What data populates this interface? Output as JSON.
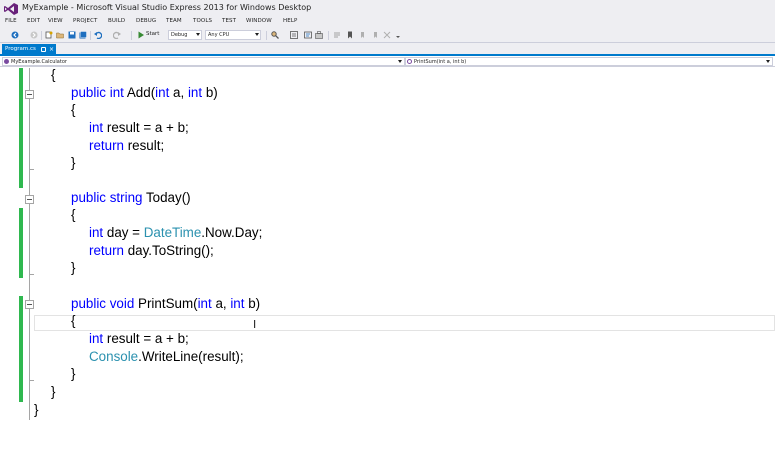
{
  "window": {
    "title": "MyExample - Microsoft Visual Studio Express 2013 for Windows Desktop"
  },
  "menu": [
    "FILE",
    "EDIT",
    "VIEW",
    "PROJECT",
    "BUILD",
    "DEBUG",
    "TEAM",
    "TOOLS",
    "TEST",
    "WINDOW",
    "HELP"
  ],
  "toolbar": {
    "start_label": "Start",
    "configuration": "Debug",
    "platform": "Any CPU"
  },
  "tabs": [
    {
      "label": "Program.cs",
      "active": true
    }
  ],
  "navigation": {
    "type_scope": "MyExample.Calculator",
    "member_scope": "PrintSum(int a, int b)"
  },
  "colors": {
    "keyword": "#0000ff",
    "type": "#2b91af",
    "accent": "#007acc",
    "changed_margin": "#2fb84f"
  },
  "code": {
    "lines": [
      {
        "parts": [
          {
            "t": "{",
            "c": "p"
          }
        ]
      },
      {
        "parts": [
          {
            "t": "public",
            "c": "kw"
          },
          {
            "t": " ",
            "c": "p"
          },
          {
            "t": "int",
            "c": "kw"
          },
          {
            "t": " Add(",
            "c": "p"
          },
          {
            "t": "int",
            "c": "kw"
          },
          {
            "t": " a, ",
            "c": "p"
          },
          {
            "t": "int",
            "c": "kw"
          },
          {
            "t": " b)",
            "c": "p"
          }
        ]
      },
      {
        "parts": [
          {
            "t": "{",
            "c": "p"
          }
        ]
      },
      {
        "parts": [
          {
            "t": "int",
            "c": "kw"
          },
          {
            "t": " result = a + b;",
            "c": "p"
          }
        ]
      },
      {
        "parts": [
          {
            "t": "return",
            "c": "kw"
          },
          {
            "t": " result;",
            "c": "p"
          }
        ]
      },
      {
        "parts": [
          {
            "t": "}",
            "c": "p"
          }
        ]
      },
      {
        "parts": []
      },
      {
        "parts": [
          {
            "t": "public",
            "c": "kw"
          },
          {
            "t": " ",
            "c": "p"
          },
          {
            "t": "string",
            "c": "kw"
          },
          {
            "t": " Today()",
            "c": "p"
          }
        ]
      },
      {
        "parts": [
          {
            "t": "{",
            "c": "p"
          }
        ]
      },
      {
        "parts": [
          {
            "t": "int",
            "c": "kw"
          },
          {
            "t": " day = ",
            "c": "p"
          },
          {
            "t": "DateTime",
            "c": "ty"
          },
          {
            "t": ".Now.Day;",
            "c": "p"
          }
        ]
      },
      {
        "parts": [
          {
            "t": "return",
            "c": "kw"
          },
          {
            "t": " day.ToString();",
            "c": "p"
          }
        ]
      },
      {
        "parts": [
          {
            "t": "}",
            "c": "p"
          }
        ]
      },
      {
        "parts": []
      },
      {
        "parts": [
          {
            "t": "public",
            "c": "kw"
          },
          {
            "t": " ",
            "c": "p"
          },
          {
            "t": "void",
            "c": "kw"
          },
          {
            "t": " PrintSum(",
            "c": "p"
          },
          {
            "t": "int",
            "c": "kw"
          },
          {
            "t": " a, ",
            "c": "p"
          },
          {
            "t": "int",
            "c": "kw"
          },
          {
            "t": " b)",
            "c": "p"
          }
        ]
      },
      {
        "parts": [
          {
            "t": "{",
            "c": "p"
          }
        ]
      },
      {
        "parts": [
          {
            "t": "int",
            "c": "kw"
          },
          {
            "t": " result = a + b;",
            "c": "p"
          }
        ]
      },
      {
        "parts": [
          {
            "t": "Console",
            "c": "ty"
          },
          {
            "t": ".WriteLine(result);",
            "c": "p"
          }
        ]
      },
      {
        "parts": [
          {
            "t": "}",
            "c": "p"
          }
        ]
      },
      {
        "parts": [
          {
            "t": "}",
            "c": "p"
          }
        ]
      },
      {
        "parts": [
          {
            "t": "}",
            "c": "p"
          }
        ]
      }
    ]
  }
}
